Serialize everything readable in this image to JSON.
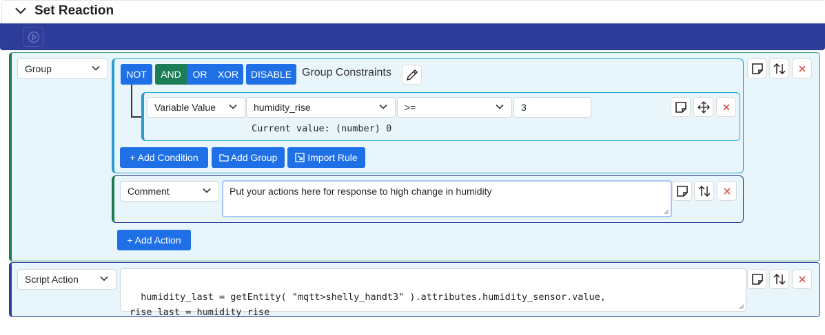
{
  "header": {
    "title": "Set Reaction"
  },
  "group": {
    "type_select": "Group",
    "logic_buttons": {
      "not": "NOT",
      "and": "AND",
      "or": "OR",
      "xor": "XOR",
      "disable": "DISABLE"
    },
    "constraints_label": "Group Constraints",
    "condition": {
      "type": "Variable Value",
      "entity": "humidity_rise",
      "operator": ">=",
      "value": "3",
      "current_value": "Current value: (number) 0"
    },
    "buttons": {
      "add_condition": "Add Condition",
      "add_group": "Add Group",
      "import_rule": "Import Rule"
    },
    "comment": {
      "type": "Comment",
      "text": "Put your actions here for response to high change in humidity"
    },
    "add_action": "Add Action"
  },
  "script": {
    "type": "Script Action",
    "code": "humidity_last = getEntity( \"mqtt>shelly_handt3\" ).attributes.humidity_sensor.value,\nrise_last = humidity_rise"
  },
  "colors": {
    "header_bar": "#2e3d9a",
    "primary_button": "#1f70e6",
    "active_button": "#1b7d55",
    "group_background": "#e8f6fb",
    "delete_icon": "#d9534f"
  }
}
